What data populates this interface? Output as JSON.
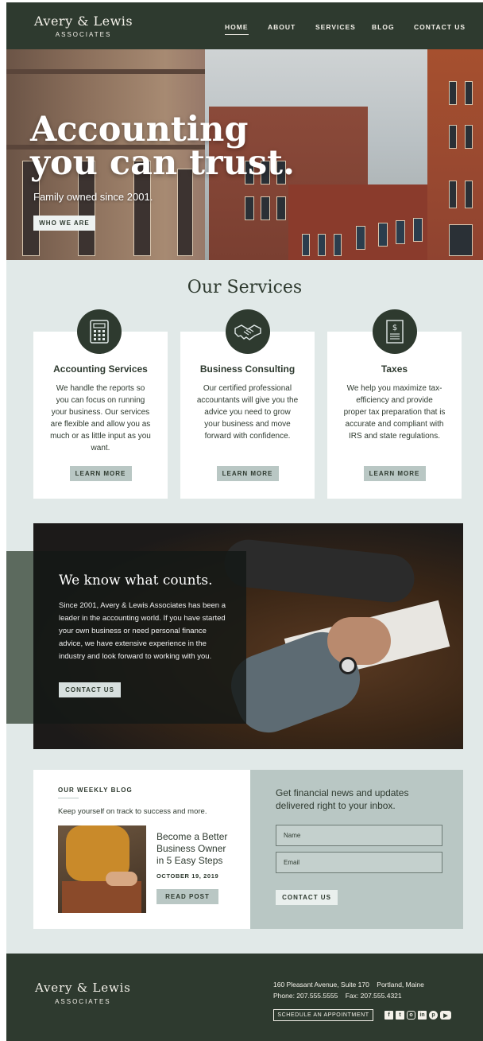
{
  "header": {
    "logo_name": "Avery & Lewis",
    "logo_sub": "ASSOCIATES",
    "nav": [
      {
        "label": "HOME",
        "active": true
      },
      {
        "label": "ABOUT"
      },
      {
        "label": "SERVICES"
      },
      {
        "label": "BLOG"
      },
      {
        "label": "CONTACT US"
      }
    ]
  },
  "hero": {
    "title_line1": "Accounting",
    "title_line2": "you can trust.",
    "subtitle": "Family owned since 2001.",
    "button": "WHO WE ARE"
  },
  "services": {
    "title": "Our Services",
    "cards": [
      {
        "icon": "calculator-icon",
        "title": "Accounting Services",
        "text": "We handle the reports so you can focus on running your business. Our services are flexible and allow you as much or as little input as you want.",
        "button": "LEARN MORE"
      },
      {
        "icon": "handshake-icon",
        "title": "Business Consulting",
        "text": "Our certified professional accountants will give you the advice you need to grow your business and move forward with confidence.",
        "button": "LEARN MORE"
      },
      {
        "icon": "tax-document-icon",
        "title": "Taxes",
        "text": "We help you maximize tax-efficiency and provide proper tax preparation that is accurate and compliant with IRS and state regulations.",
        "button": "LEARN MORE"
      }
    ]
  },
  "about": {
    "title": "We know what counts.",
    "text": "Since 2001, Avery & Lewis Associates has been a leader in the accounting world. If you have started your own business or need personal finance advice, we have extensive experience in the industry and look forward to working with you.",
    "button": "CONTACT US"
  },
  "blog": {
    "eyebrow": "OUR WEEKLY BLOG",
    "intro": "Keep yourself on track to success and more.",
    "post_title": "Become a Better Business Owner in 5 Easy Steps",
    "post_date": "OCTOBER 19, 2019",
    "button": "READ POST"
  },
  "newsletter": {
    "heading": "Get financial news and updates delivered right to your inbox.",
    "name_placeholder": "Name",
    "email_placeholder": "Email",
    "button": "CONTACT US"
  },
  "footer": {
    "logo_name": "Avery & Lewis",
    "logo_sub": "ASSOCIATES",
    "address_line": "160 Pleasant Avenue, Suite 170    Portland, Maine",
    "phone_line": "Phone: 207.555.5555    Fax: 207.555.4321",
    "schedule_button": "SCHEDULE AN APPOINTMENT",
    "socials": [
      "facebook-icon",
      "twitter-icon",
      "instagram-icon",
      "linkedin-icon",
      "pinterest-icon",
      "youtube-icon"
    ]
  },
  "colors": {
    "dark_green": "#2e3a2f",
    "sage": "#b9c7c4",
    "page_bg": "#e1e9e8"
  }
}
